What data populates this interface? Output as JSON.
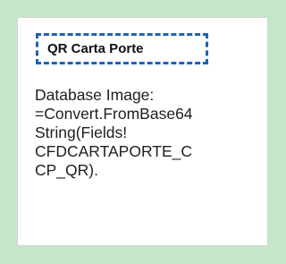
{
  "image_item": {
    "title": "QR Carta Porte",
    "expression_lines": [
      "Database Image:",
      "=Convert.FromBase64",
      "String(Fields!",
      "CFDCARTAPORTE_C",
      "CP_QR)."
    ]
  },
  "colors": {
    "background": "#c5e7c9",
    "box": "#ffffff",
    "selection_border": "#1f60b5",
    "text": "#1e1e1e"
  }
}
